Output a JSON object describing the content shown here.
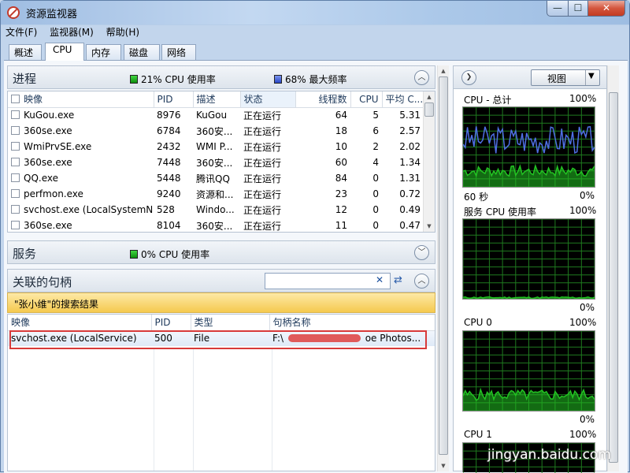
{
  "window": {
    "title": "资源监视器",
    "minimize": "—",
    "maximize": "☐",
    "close": "✕"
  },
  "menu": [
    "文件(F)",
    "监视器(M)",
    "帮助(H)"
  ],
  "tabs": [
    "概述",
    "CPU",
    "内存",
    "磁盘",
    "网络"
  ],
  "active_tab": "CPU",
  "process_panel": {
    "title": "进程",
    "cpu_usage": "21% CPU 使用率",
    "max_freq": "68% 最大频率",
    "columns": [
      "映像",
      "PID",
      "描述",
      "状态",
      "线程数",
      "CPU",
      "平均 C..."
    ],
    "rows": [
      [
        "KuGou.exe",
        "8976",
        "KuGou",
        "正在运行",
        "64",
        "5",
        "5.31"
      ],
      [
        "360se.exe",
        "6784",
        "360安...",
        "正在运行",
        "18",
        "6",
        "2.57"
      ],
      [
        "WmiPrvSE.exe",
        "2432",
        "WMI P...",
        "正在运行",
        "10",
        "2",
        "2.02"
      ],
      [
        "360se.exe",
        "7448",
        "360安...",
        "正在运行",
        "60",
        "4",
        "1.34"
      ],
      [
        "QQ.exe",
        "5448",
        "腾讯QQ",
        "正在运行",
        "84",
        "0",
        "1.31"
      ],
      [
        "perfmon.exe",
        "9240",
        "资源和...",
        "正在运行",
        "23",
        "0",
        "0.72"
      ],
      [
        "svchost.exe (LocalSystemN...",
        "528",
        "Windo...",
        "正在运行",
        "12",
        "0",
        "0.49"
      ],
      [
        "360se.exe",
        "8104",
        "360安...",
        "正在运行",
        "11",
        "0",
        "0.47"
      ]
    ]
  },
  "services_panel": {
    "title": "服务",
    "cpu_usage": "0% CPU 使用率"
  },
  "handles_panel": {
    "title": "关联的句柄",
    "search_value": "",
    "result_text": "\"张小维\"的搜索结果",
    "columns": [
      "映像",
      "PID",
      "类型",
      "句柄名称"
    ],
    "rows": [
      [
        "svchost.exe (LocalService)",
        "500",
        "File",
        "F:\\",
        "oe Photos..."
      ]
    ]
  },
  "right_panel": {
    "view_button": "视图",
    "graphs": [
      {
        "title": "CPU - 总计",
        "max": "100%",
        "footer_left": "60 秒",
        "footer_right": "0%"
      },
      {
        "title": "服务 CPU 使用率",
        "max": "100%",
        "footer_left": "",
        "footer_right": "0%"
      },
      {
        "title": "CPU 0",
        "max": "100%",
        "footer_left": "",
        "footer_right": "0%"
      },
      {
        "title": "CPU 1",
        "max": "100%",
        "footer_left": "",
        "footer_right": ""
      }
    ],
    "colors": {
      "usage": "#22c322",
      "freq": "#4f6fe3",
      "grid": "#1f7a1f"
    }
  },
  "watermark": "jingyan.baidu.com"
}
